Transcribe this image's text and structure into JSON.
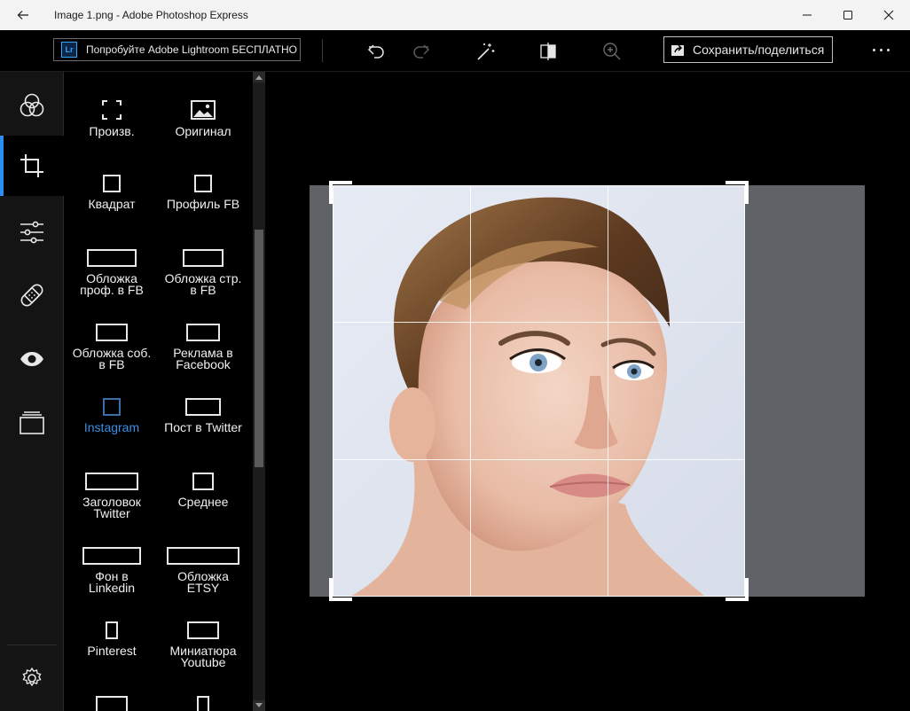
{
  "window": {
    "title": "Image 1.png - Adobe Photoshop Express"
  },
  "toolbar": {
    "promo_badge": "Lr",
    "promo_label": "Попробуйте Adobe Lightroom БЕСПЛАТНО",
    "save_label": "Сохранить/поделиться",
    "icons": [
      "undo-icon",
      "redo-icon",
      "auto-fix-icon",
      "compare-icon",
      "zoom-icon"
    ]
  },
  "rail": {
    "items": [
      {
        "name": "looks",
        "icon": "filters-icon"
      },
      {
        "name": "crop",
        "icon": "crop-icon",
        "active": true
      },
      {
        "name": "adjustments",
        "icon": "sliders-icon"
      },
      {
        "name": "heal",
        "icon": "bandage-icon"
      },
      {
        "name": "eyes",
        "icon": "eye-icon"
      },
      {
        "name": "borders",
        "icon": "border-stack-icon"
      }
    ],
    "settings_icon": "gear-icon"
  },
  "presets": [
    {
      "label": "Произв."
    },
    {
      "label": "Оригинал"
    },
    {
      "label": "Квадрат"
    },
    {
      "label": "Профиль FB"
    },
    {
      "label": "Обложка\nпроф. в FB"
    },
    {
      "label": "Обложка стр.\nв FB"
    },
    {
      "label": "Обложка соб.\nв FB"
    },
    {
      "label": "Реклама в\nFacebook"
    },
    {
      "label": "Instagram",
      "selected": true
    },
    {
      "label": "Пост в Twitter"
    },
    {
      "label": "Заголовок\nTwitter"
    },
    {
      "label": "Среднее"
    },
    {
      "label": "Фон в\nLinkedin"
    },
    {
      "label": "Обложка\nETSY"
    },
    {
      "label": "Pinterest"
    },
    {
      "label": "Миниатюра\nYoutube"
    },
    {
      "label": ""
    },
    {
      "label": ""
    }
  ],
  "colors": {
    "accent": "#2b8ff0",
    "selected_text": "#3b8fe6",
    "photo_background": "#5f6266"
  }
}
